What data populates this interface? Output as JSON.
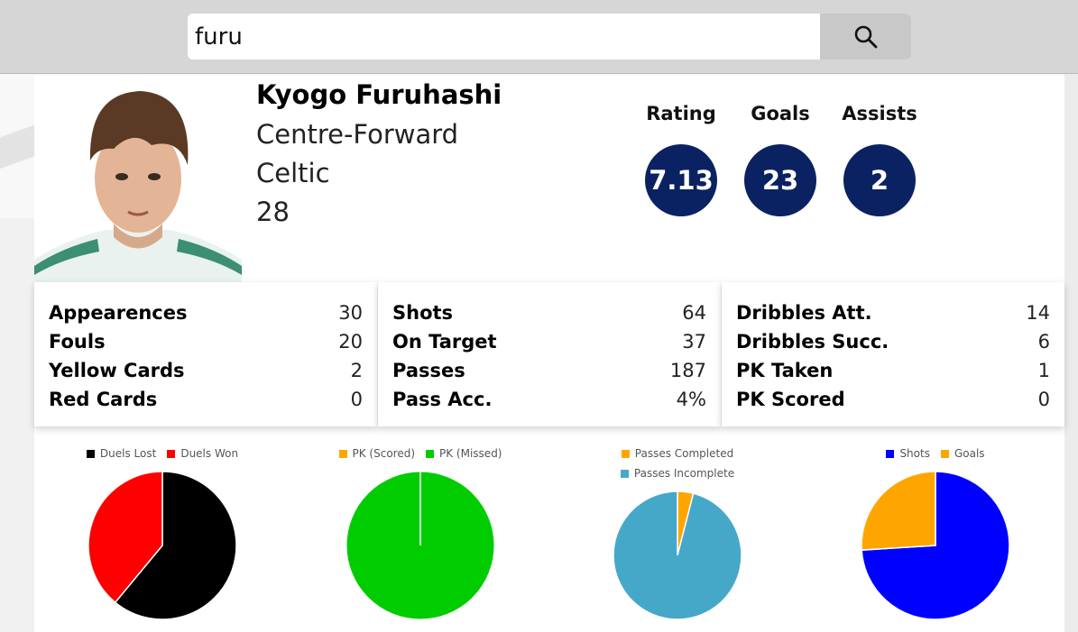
{
  "search": {
    "value": "furu",
    "button_icon": "search-icon"
  },
  "player": {
    "name": "Kyogo Furuhashi",
    "position": "Centre-Forward",
    "team": "Celtic",
    "age": "28"
  },
  "headline_stats": [
    {
      "label": "Rating",
      "value": "7.13"
    },
    {
      "label": "Goals",
      "value": "23"
    },
    {
      "label": "Assists",
      "value": "2"
    }
  ],
  "panels": [
    {
      "rows": [
        {
          "label": "Appearences",
          "value": "30"
        },
        {
          "label": "Fouls",
          "value": "20"
        },
        {
          "label": "Yellow Cards",
          "value": "2"
        },
        {
          "label": "Red Cards",
          "value": "0"
        }
      ]
    },
    {
      "rows": [
        {
          "label": "Shots",
          "value": "64"
        },
        {
          "label": "On Target",
          "value": "37"
        },
        {
          "label": "Passes",
          "value": "187"
        },
        {
          "label": "Pass Acc.",
          "value": "4%"
        }
      ]
    },
    {
      "rows": [
        {
          "label": "Dribbles Att.",
          "value": "14"
        },
        {
          "label": "Dribbles Succ.",
          "value": "6"
        },
        {
          "label": "PK Taken",
          "value": "1"
        },
        {
          "label": "PK Scored",
          "value": "0"
        }
      ]
    }
  ],
  "colors": {
    "circle": "#0b2262"
  },
  "chart_data": [
    {
      "type": "pie",
      "series": [
        {
          "name": "Duels Lost",
          "value": 61,
          "color": "#000000"
        },
        {
          "name": "Duels Won",
          "value": 39,
          "color": "#ff0000"
        }
      ]
    },
    {
      "type": "pie",
      "series": [
        {
          "name": "PK (Scored)",
          "value": 0,
          "color": "#ffa500"
        },
        {
          "name": "PK (Missed)",
          "value": 1,
          "color": "#00cc00"
        }
      ]
    },
    {
      "type": "pie",
      "series": [
        {
          "name": "Passes Completed",
          "value": 4,
          "color": "#ffa500"
        },
        {
          "name": "Passes Incomplete",
          "value": 96,
          "color": "#46a8c8"
        }
      ]
    },
    {
      "type": "pie",
      "series": [
        {
          "name": "Shots",
          "value": 74,
          "color": "#0000ff"
        },
        {
          "name": "Goals",
          "value": 26,
          "color": "#ffa500"
        }
      ]
    }
  ]
}
